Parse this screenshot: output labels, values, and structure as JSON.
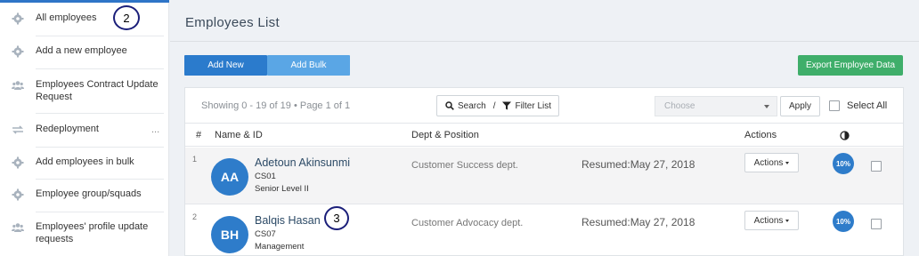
{
  "sidebar": {
    "items": [
      {
        "label": "All employees",
        "icon": "gear-icon"
      },
      {
        "label": "Add a new employee",
        "icon": "gear-icon"
      },
      {
        "label": "Employees Contract Update Request",
        "icon": "users-icon"
      },
      {
        "label": "Redeployment",
        "icon": "swap-icon",
        "more": "..."
      },
      {
        "label": "Add employees in bulk",
        "icon": "gear-icon"
      },
      {
        "label": "Employee group/squads",
        "icon": "gear-icon"
      },
      {
        "label": "Employees' profile update requests",
        "icon": "users-icon"
      }
    ]
  },
  "annotations": {
    "badge_2": "2",
    "badge_3": "3"
  },
  "main": {
    "title": "Employees  List",
    "add_new_label": "Add New",
    "add_bulk_label": "Add Bulk",
    "export_label": "Export Employee Data",
    "showing_text": "Showing 0 - 19 of 19 • Page 1 of 1",
    "search_label": "Search",
    "separator": "/",
    "filter_label": "Filter List",
    "choose_placeholder": "Choose",
    "apply_label": "Apply",
    "select_all_label": "Select All",
    "columns": {
      "index": "#",
      "name": "Name & ID",
      "dept": "Dept & Position",
      "actions": "Actions"
    },
    "rows": [
      {
        "index": "1",
        "initials": "AA",
        "name": "Adetoun Akinsunmi",
        "code": "CS01",
        "level": "Senior Level II",
        "dept": "Customer Success dept.",
        "status": "Resumed:May 27, 2018",
        "actions_label": "Actions",
        "progress": "10%"
      },
      {
        "index": "2",
        "initials": "BH",
        "name": "Balqis Hasan",
        "code": "CS07",
        "level": "Management",
        "dept": "Customer Advocacy dept.",
        "status": "Resumed:May 27, 2018",
        "actions_label": "Actions",
        "progress": "10%"
      }
    ]
  },
  "colors": {
    "primary": "#2b7bcc",
    "secondary": "#5aa6e5",
    "export": "#3fae6a",
    "avatar": "#2e7cca"
  }
}
